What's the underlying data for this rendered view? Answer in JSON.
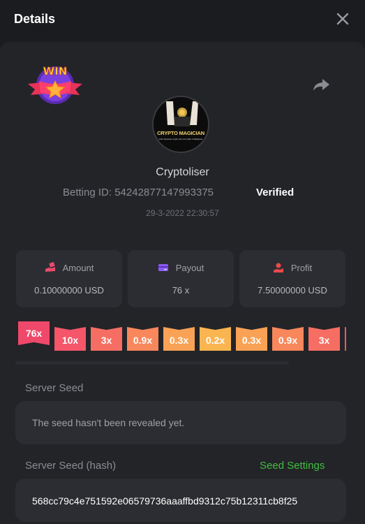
{
  "header": {
    "title": "Details",
    "close_icon": "close-icon"
  },
  "badge": {
    "text": "WIN"
  },
  "player": {
    "avatar_text": "CRYPTO MAGICIAN",
    "avatar_subtext": "work because crypto can not make it disappear",
    "username": "Cryptoliser",
    "betting_id": "Betting ID: 54242877147993375",
    "verified": "Verified",
    "date": "29-3-2022 22:30:57"
  },
  "stats": [
    {
      "label": "Amount",
      "value": "0.10000000 USD",
      "icon": "money-hand-icon",
      "icon_color": "#e94a6d"
    },
    {
      "label": "Payout",
      "value": "76 x",
      "icon": "card-icon",
      "icon_color": "#8b5cf6"
    },
    {
      "label": "Profit",
      "value": "7.50000000 USD",
      "icon": "profit-hand-icon",
      "icon_color": "#e94a4a"
    }
  ],
  "multipliers": [
    {
      "label": "76x",
      "color": "#f0486a"
    },
    {
      "label": "10x",
      "color": "#f5566a"
    },
    {
      "label": "3x",
      "color": "#f66e63"
    },
    {
      "label": "0.9x",
      "color": "#f8875c"
    },
    {
      "label": "0.3x",
      "color": "#f9a255"
    },
    {
      "label": "0.2x",
      "color": "#fbb550"
    },
    {
      "label": "0.3x",
      "color": "#f9a255"
    },
    {
      "label": "0.9x",
      "color": "#f8875c"
    },
    {
      "label": "3x",
      "color": "#f66e63"
    },
    {
      "label": "",
      "color": "#f5566a"
    }
  ],
  "server_seed": {
    "label": "Server Seed",
    "value": "The seed hasn't been revealed yet."
  },
  "server_seed_hash": {
    "label": "Server Seed (hash)",
    "settings_link": "Seed Settings",
    "value": "568cc79c4e751592e06579736aaaffbd9312c75b12311cb8f25"
  }
}
